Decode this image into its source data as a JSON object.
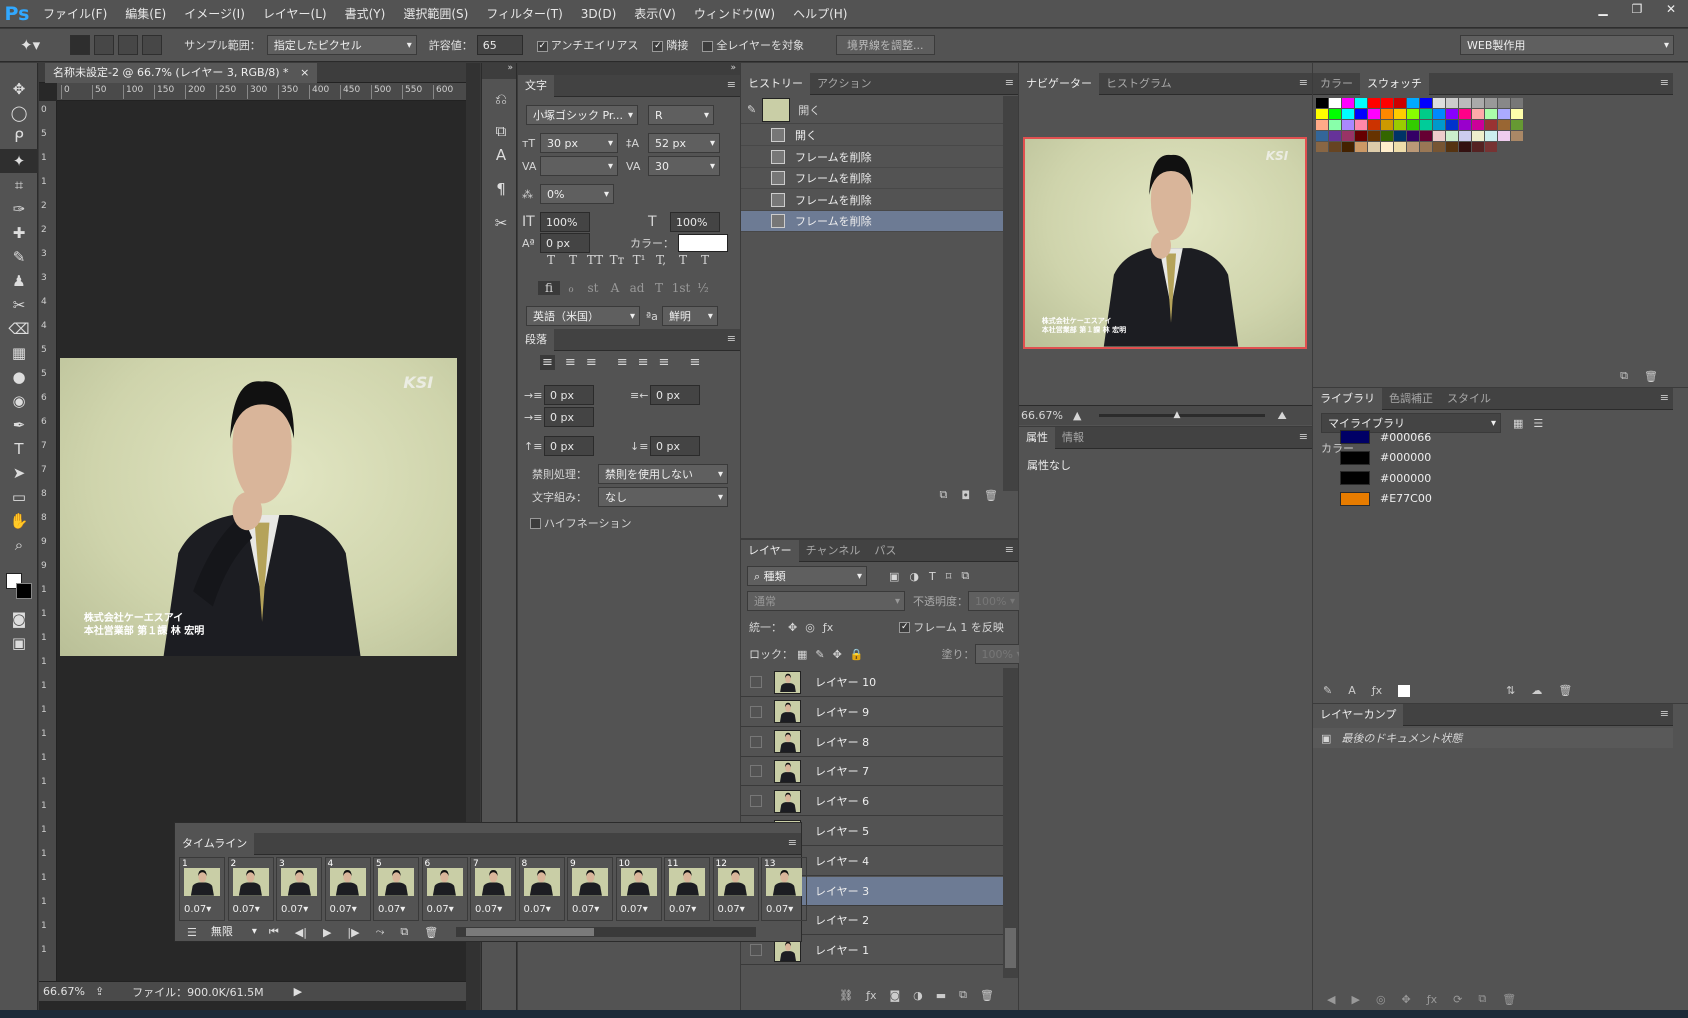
{
  "app": {
    "logo": "Ps"
  },
  "menu": [
    "ファイル(F)",
    "編集(E)",
    "イメージ(I)",
    "レイヤー(L)",
    "書式(Y)",
    "選択範囲(S)",
    "フィルター(T)",
    "3D(D)",
    "表示(V)",
    "ウィンドウ(W)",
    "ヘルプ(H)"
  ],
  "window_controls": [
    "▁",
    "❐",
    "✕"
  ],
  "options": {
    "sample_label": "サンプル範囲：",
    "sample_value": "指定したピクセル",
    "tolerance_label": "許容値：",
    "tolerance_value": "65",
    "antialias": "アンチエイリアス",
    "contiguous": "隣接",
    "all_layers": "全レイヤーを対象",
    "refine_edge": "境界線を調整...",
    "workspace": "WEB製作用"
  },
  "document": {
    "tab": "名称未設定-2 @ 66.7% (レイヤー 3, RGB/8) *",
    "close": "×",
    "ruler_h": [
      "0",
      "50",
      "100",
      "150",
      "200",
      "250",
      "300",
      "350",
      "400",
      "450",
      "500",
      "550",
      "600"
    ],
    "ruler_v": [
      "0",
      "5",
      "1",
      "1",
      "2",
      "2",
      "3",
      "3",
      "4",
      "4",
      "5",
      "5",
      "6",
      "6",
      "7",
      "7",
      "8",
      "8",
      "9",
      "9",
      "1",
      "1",
      "1",
      "1",
      "1",
      "1",
      "1",
      "1",
      "1",
      "1",
      "1",
      "1",
      "1",
      "1",
      "1",
      "1"
    ],
    "zoom": "66.67%",
    "file_info": "ファイル：900.0K/61.5M"
  },
  "photo": {
    "logo": "KSI",
    "caption1": "株式会社ケーエスアイ",
    "caption2": "本社営業部 第１課 林 宏明"
  },
  "character": {
    "tab": "文字",
    "font": "小塚ゴシック Pr...",
    "style": "R",
    "size": "30 px",
    "leading": "52 px",
    "tracking": "30",
    "scale_pct": "0%",
    "v_scale": "100%",
    "h_scale": "100%",
    "baseline": "0 px",
    "color_label": "カラー：",
    "language": "英語（米国）",
    "aa": "鮮明",
    "type_btns": [
      "T",
      "T",
      "TT",
      "Tт",
      "T¹",
      "T,",
      "T",
      "T"
    ],
    "ot_btns": [
      "fi",
      "ℴ",
      "st",
      "A",
      "ad",
      "T",
      "1st",
      "½"
    ]
  },
  "paragraph": {
    "tab": "段落",
    "indent_left": "0 px",
    "indent_right": "0 px",
    "first_line": "0 px",
    "space_before": "0 px",
    "space_after": "0 px",
    "kinsoku_label": "禁則処理：",
    "kinsoku_value": "禁則を使用しない",
    "mojikumi_label": "文字組み：",
    "mojikumi_value": "なし",
    "hyphenation": "ハイフネーション"
  },
  "history": {
    "tabs": [
      "ヒストリー",
      "アクション"
    ],
    "snapshot": "開く",
    "items": [
      "開く",
      "フレームを削除",
      "フレームを削除",
      "フレームを削除",
      "フレームを削除"
    ]
  },
  "layers": {
    "tabs": [
      "レイヤー",
      "チャンネル",
      "パス"
    ],
    "filter": "種類",
    "blend": "通常",
    "opacity_label": "不透明度：",
    "opacity": "100%",
    "unify_label": "統一：",
    "propagate": "フレーム 1 を反映",
    "lock_label": "ロック：",
    "fill_label": "塗り：",
    "fill": "100%",
    "items": [
      "レイヤー 10",
      "レイヤー 9",
      "レイヤー 8",
      "レイヤー 7",
      "レイヤー 6",
      "レイヤー 5",
      "レイヤー 4",
      "レイヤー 3",
      "レイヤー 2",
      "レイヤー 1"
    ],
    "selected_index": 7
  },
  "navigator": {
    "tabs": [
      "ナビゲーター",
      "ヒストグラム"
    ],
    "zoom": "66.67%"
  },
  "properties": {
    "tabs": [
      "属性",
      "情報"
    ],
    "text": "属性なし"
  },
  "swatches": {
    "tabs": [
      "カラー",
      "スウォッチ"
    ]
  },
  "library": {
    "tabs": [
      "ライブラリ",
      "色調補正",
      "スタイル"
    ],
    "name": "マイライブラリ",
    "section": "カラー",
    "colors": [
      {
        "hex": "#000066",
        "label": "#000066"
      },
      {
        "hex": "#000000",
        "label": "#000000"
      },
      {
        "hex": "#000000",
        "label": "#000000"
      },
      {
        "hex": "#E77C00",
        "label": "#E77C00"
      }
    ]
  },
  "layer_comps": {
    "tab": "レイヤーカンプ",
    "item": "最後のドキュメント状態"
  },
  "timeline": {
    "tab": "タイムライン",
    "loop": "無限",
    "frames": [
      {
        "n": "1",
        "d": "0.07▾"
      },
      {
        "n": "2",
        "d": "0.07▾"
      },
      {
        "n": "3",
        "d": "0.07▾"
      },
      {
        "n": "4",
        "d": "0.07▾"
      },
      {
        "n": "5",
        "d": "0.07▾"
      },
      {
        "n": "6",
        "d": "0.07▾"
      },
      {
        "n": "7",
        "d": "0.07▾"
      },
      {
        "n": "8",
        "d": "0.07▾"
      },
      {
        "n": "9",
        "d": "0.07▾"
      },
      {
        "n": "10",
        "d": "0.07▾"
      },
      {
        "n": "11",
        "d": "0.07▾"
      },
      {
        "n": "12",
        "d": "0.07▾"
      },
      {
        "n": "13",
        "d": "0.07▾"
      }
    ]
  },
  "tools": [
    "✥",
    "◯",
    "ᑭ",
    "✦",
    "⌗",
    "✑",
    "✚",
    "✎",
    "♟",
    "✂",
    "⌫",
    "▦",
    "●",
    "◉",
    "✒",
    "T",
    "➤",
    "▭",
    "✋",
    "⌕"
  ]
}
